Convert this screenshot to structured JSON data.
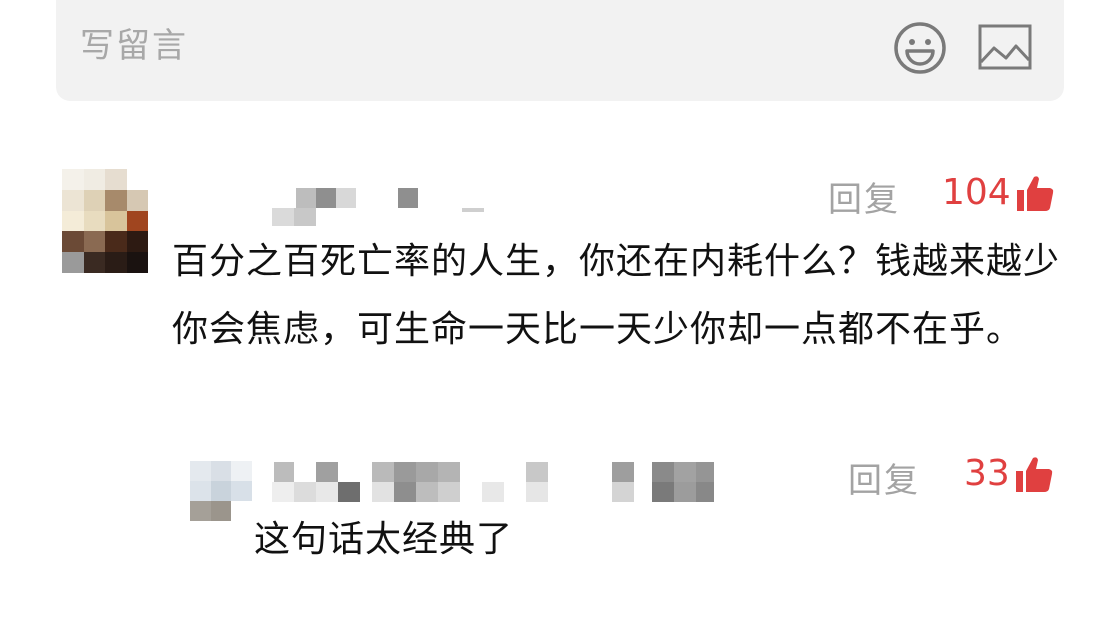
{
  "input": {
    "placeholder": "写留言",
    "emoji_icon": "smiley-face-icon",
    "image_icon": "image-picture-icon"
  },
  "comments": [
    {
      "text": "百分之百死亡率的人生，你还在内耗什么？钱越来越少你会焦虑，可生命一天比一天少你却一点都不在乎。",
      "reply_label": "回复",
      "likes": "104",
      "like_icon": "thumbs-up-icon",
      "like_color": "#e04040",
      "avatar": "pixelated-avatar",
      "username": "pixelated-username"
    }
  ],
  "replies": [
    {
      "text": "这句话太经典了",
      "reply_label": "回复",
      "likes": "33",
      "like_icon": "thumbs-up-icon",
      "like_color": "#e04040",
      "avatar": "pixelated-avatar",
      "username": "pixelated-username"
    }
  ]
}
